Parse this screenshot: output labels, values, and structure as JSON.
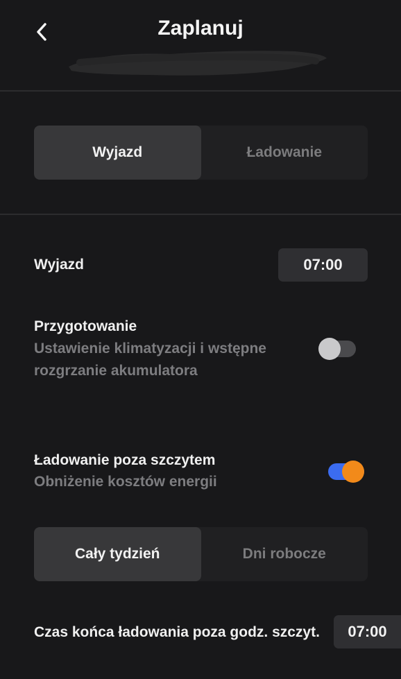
{
  "header": {
    "title": "Zaplanuj",
    "back_icon": "chevron-left-icon"
  },
  "mode_tabs": {
    "items": [
      {
        "label": "Wyjazd",
        "active": true
      },
      {
        "label": "Ładowanie",
        "active": false
      }
    ]
  },
  "departure": {
    "label": "Wyjazd",
    "time": "07:00"
  },
  "preconditioning": {
    "label": "Przygotowanie",
    "description_line1": "Ustawienie klimatyzacji i wstępne",
    "description_line2": "rozgrzanie akumulatora",
    "enabled": false
  },
  "off_peak": {
    "label": "Ładowanie poza szczytem",
    "description": "Obniżenie kosztów energii",
    "enabled": true
  },
  "days_tabs": {
    "items": [
      {
        "label": "Cały tydzień",
        "active": true
      },
      {
        "label": "Dni robocze",
        "active": false
      }
    ]
  },
  "off_peak_end": {
    "label": "Czas końca ładowania poza godz. szczyt.",
    "time": "07:00"
  },
  "colors": {
    "background": "#18181a",
    "toggle_on_track": "#3b6cf0",
    "toggle_on_knob": "#f28a1a",
    "toggle_off_knob": "#c9c9cb"
  }
}
